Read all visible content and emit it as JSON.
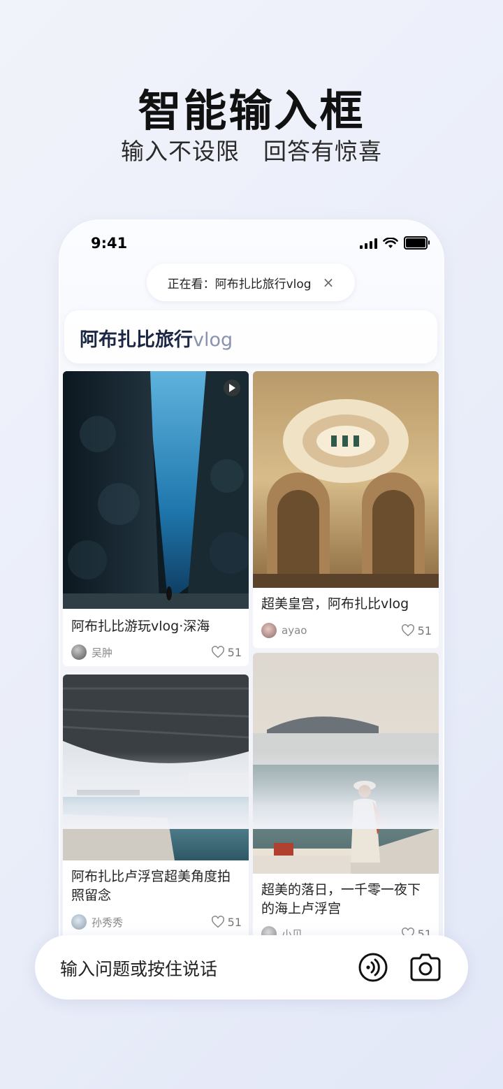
{
  "promo": {
    "headline": "智能输入框",
    "subline": "输入不设限　回答有惊喜"
  },
  "status_bar": {
    "time": "9:41",
    "battery_level": 1.0
  },
  "watching_pill": {
    "label": "正在看：阿布扎比旅行vlog",
    "close_icon": "×"
  },
  "query": {
    "main": "阿布扎比旅行",
    "suffix": "vlog"
  },
  "cards": [
    {
      "title": "阿布扎比游玩vlog·深海",
      "author": "吴肿",
      "likes": "51",
      "has_video": true
    },
    {
      "title": "超美皇宫，阿布扎比vlog",
      "author": "ayao",
      "likes": "51",
      "has_video": false
    },
    {
      "title": "阿布扎比卢浮宫超美角度拍照留念",
      "author": "孙秀秀",
      "likes": "51",
      "has_video": false
    },
    {
      "title": "超美的落日，一千零一夜下的海上卢浮宫",
      "author": "小贝",
      "likes": "51",
      "has_video": false
    }
  ],
  "input_bar": {
    "placeholder": "输入问题或按住说话",
    "voice_icon": "voice-wave-icon",
    "camera_icon": "camera-icon"
  },
  "colors": {
    "query_main": "#1c2744",
    "query_suffix": "#8a93ad",
    "background": "#eceff9"
  }
}
